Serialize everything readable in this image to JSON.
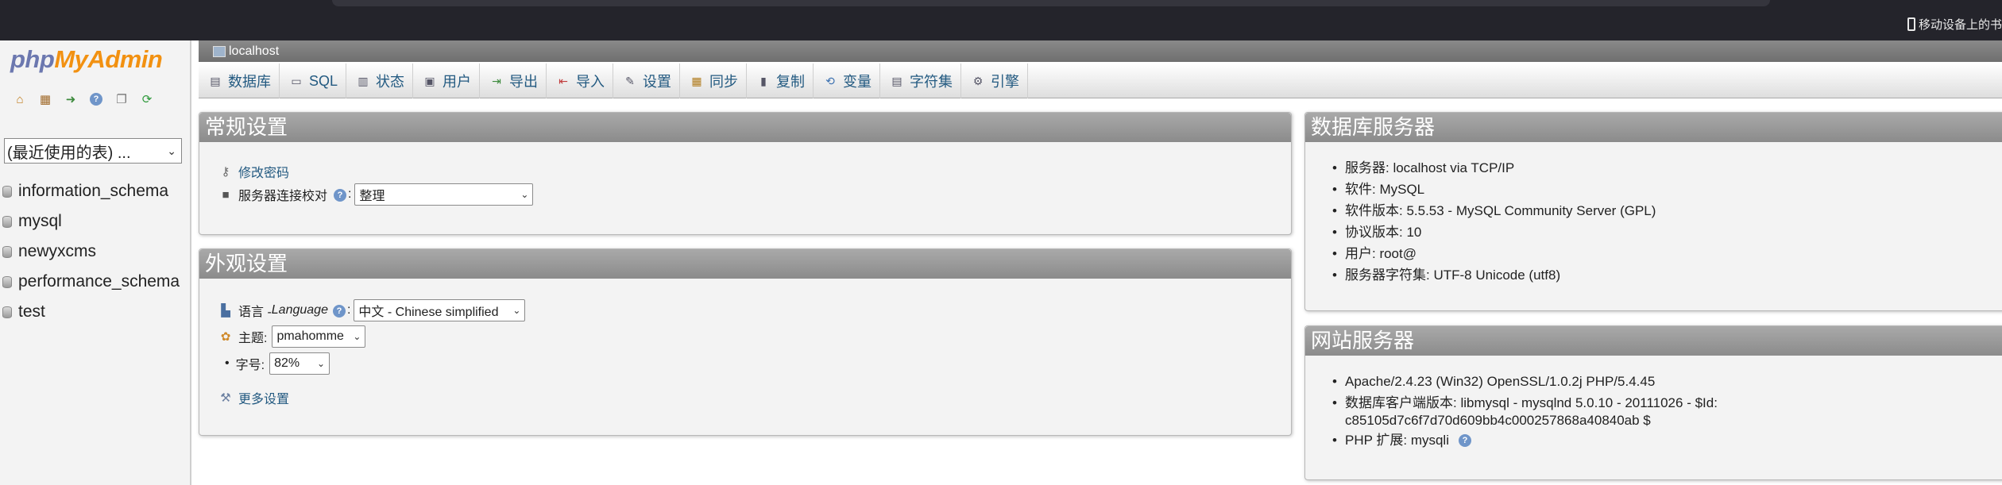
{
  "browser": {
    "mobile_bookmarks": "移动设备上的书"
  },
  "logo": {
    "php": "php",
    "my": "My",
    "admin": "Admin"
  },
  "nav_icons": [
    "home-icon",
    "database-icon",
    "sign-out-icon",
    "help-icon",
    "docs-icon",
    "reload-icon"
  ],
  "recent_tables": {
    "label": "(最近使用的表) ..."
  },
  "databases": [
    "information_schema",
    "mysql",
    "newyxcms",
    "performance_schema",
    "test"
  ],
  "server_bar": {
    "label": "localhost"
  },
  "tabs": [
    {
      "label": "数据库",
      "icon": "database-icon"
    },
    {
      "label": "SQL",
      "icon": "sql-icon"
    },
    {
      "label": "状态",
      "icon": "status-icon"
    },
    {
      "label": "用户",
      "icon": "users-icon"
    },
    {
      "label": "导出",
      "icon": "export-icon"
    },
    {
      "label": "导入",
      "icon": "import-icon"
    },
    {
      "label": "设置",
      "icon": "settings-icon"
    },
    {
      "label": "同步",
      "icon": "sync-icon"
    },
    {
      "label": "复制",
      "icon": "replication-icon"
    },
    {
      "label": "变量",
      "icon": "variables-icon"
    },
    {
      "label": "字符集",
      "icon": "charset-icon"
    },
    {
      "label": "引擎",
      "icon": "engine-icon"
    }
  ],
  "general_settings": {
    "title": "常规设置",
    "change_password": "修改密码",
    "collation_label": "服务器连接校对",
    "collation_value": "整理"
  },
  "appearance_settings": {
    "title": "外观设置",
    "language_label": "语言 - ",
    "language_italic": "Language",
    "language_value": "中文 - Chinese simplified",
    "theme_label": "主题:",
    "theme_value": "pmahomme",
    "font_label": "字号:",
    "font_value": "82%",
    "more_settings": "更多设置"
  },
  "db_server": {
    "title": "数据库服务器",
    "items": [
      "服务器: localhost via TCP/IP",
      "软件: MySQL",
      "软件版本: 5.5.53 - MySQL Community Server (GPL)",
      "协议版本: 10",
      "用户: root@",
      "服务器字符集: UTF-8 Unicode (utf8)"
    ]
  },
  "web_server": {
    "title": "网站服务器",
    "apache": "Apache/2.4.23 (Win32) OpenSSL/1.0.2j PHP/5.4.45",
    "client_line1": "数据库客户端版本: libmysql - mysqlnd 5.0.10 - 20111026 - $Id:",
    "client_line2": "c85105d7c6f7d70d609bb4c000257868a40840ab $",
    "php_ext": "PHP 扩展: mysqli"
  }
}
